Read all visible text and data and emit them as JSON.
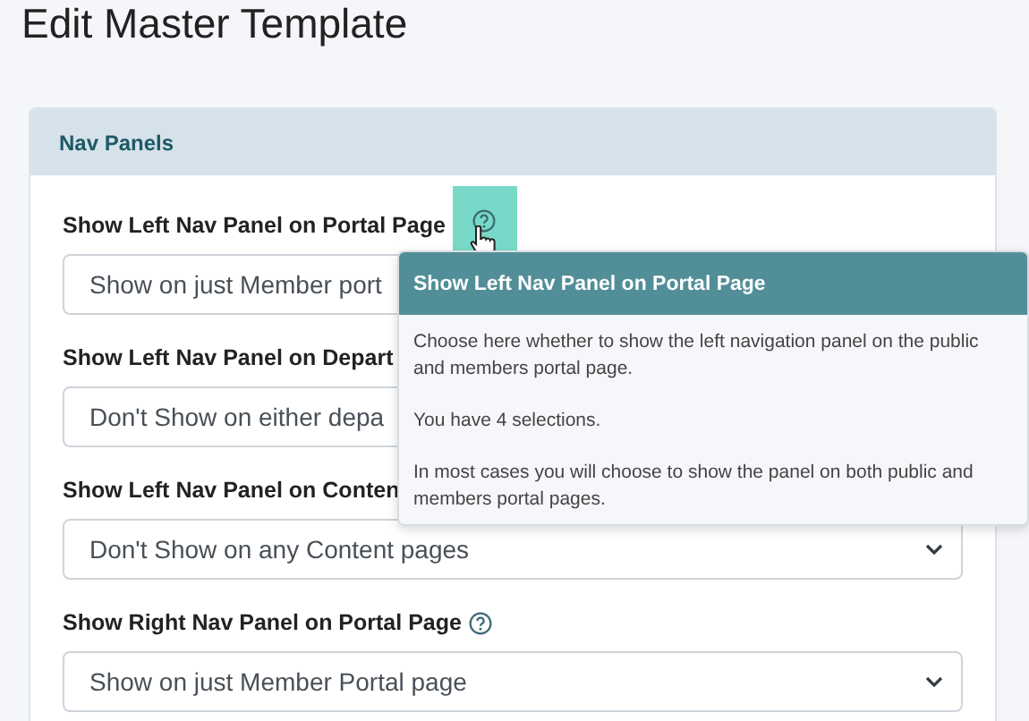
{
  "page": {
    "title": "Edit Master Template"
  },
  "card": {
    "title": "Nav Panels"
  },
  "fields": [
    {
      "label": "Show Left Nav Panel on Portal Page",
      "help": true,
      "hovered": true,
      "value": "Show on just Member port",
      "chevron": false
    },
    {
      "label": "Show Left Nav Panel on Depart",
      "help": false,
      "hovered": false,
      "value": "Don't Show on either depa",
      "chevron": false
    },
    {
      "label": "Show Left Nav Panel on Conten",
      "help": false,
      "hovered": false,
      "value": "Don't Show on any Content pages",
      "chevron": true
    },
    {
      "label": "Show Right Nav Panel on Portal Page",
      "help": true,
      "hovered": false,
      "value": "Show on just Member Portal page",
      "chevron": true
    }
  ],
  "tooltip": {
    "title": "Show Left Nav Panel on Portal Page",
    "paragraphs": [
      "Choose here whether to show the left navigation panel on the public and members portal page.",
      "You have 4 selections.",
      "In most cases you will choose to show the panel on both public and members portal pages."
    ]
  }
}
